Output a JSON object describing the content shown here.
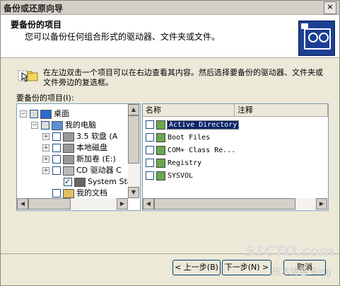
{
  "window": {
    "title": "备份或还原向导",
    "close_glyph": "×"
  },
  "header": {
    "title": "要备份的项目",
    "subtitle": "您可以备份任何组合形式的驱动器、文件夹或文件。"
  },
  "instruction": "在左边双击一个项目可以在右边查看其内容。然后选择要备份的驱动器、文件夹或文件旁边的复选框。",
  "items_label": "要备份的项目(I):",
  "tree": [
    {
      "label": "桌面",
      "expander": "−",
      "checked": false,
      "gray": true
    },
    {
      "label": "我的电脑",
      "expander": "−",
      "checked": false,
      "gray": true
    },
    {
      "label": "3.5 软盘 (A",
      "expander": "+",
      "checked": false,
      "gray": false
    },
    {
      "label": "本地磁盘",
      "expander": "+",
      "checked": false,
      "gray": false
    },
    {
      "label": "新加卷 (E:)",
      "expander": "+",
      "checked": false,
      "gray": false
    },
    {
      "label": "CD 驱动器 C",
      "expander": "+",
      "checked": false,
      "gray": false
    },
    {
      "label": "System Stat",
      "expander": "",
      "checked": true,
      "gray": false
    },
    {
      "label": "我的文档",
      "expander": "",
      "checked": false,
      "gray": false
    }
  ],
  "list": {
    "columns": [
      "名称",
      "注释"
    ],
    "rows": [
      {
        "label": "Active Directory",
        "selected": true
      },
      {
        "label": "Boot Files",
        "selected": false
      },
      {
        "label": "COM+ Class Re...",
        "selected": false
      },
      {
        "label": "Registry",
        "selected": false
      },
      {
        "label": "SYSVOL",
        "selected": false
      }
    ]
  },
  "buttons": {
    "back": "< 上一步(B)",
    "next": "下一步(N) >",
    "cancel": "取消"
  },
  "watermark": {
    "site": "51CTO.com",
    "blog": "技术博客  Blog"
  },
  "colors": {
    "selection": "#0a246a",
    "header_icon": "#1c3f95"
  }
}
